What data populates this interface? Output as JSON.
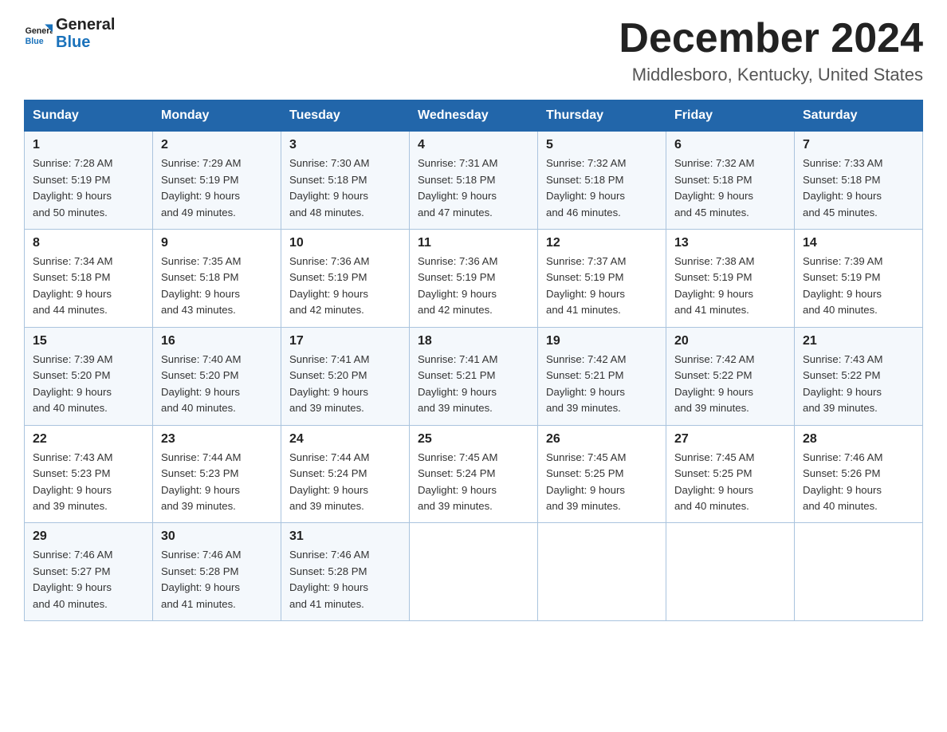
{
  "header": {
    "logo_text_general": "General",
    "logo_text_blue": "Blue",
    "month_title": "December 2024",
    "location": "Middlesboro, Kentucky, United States"
  },
  "weekdays": [
    "Sunday",
    "Monday",
    "Tuesday",
    "Wednesday",
    "Thursday",
    "Friday",
    "Saturday"
  ],
  "weeks": [
    [
      {
        "day": "1",
        "sunrise": "7:28 AM",
        "sunset": "5:19 PM",
        "daylight": "9 hours and 50 minutes."
      },
      {
        "day": "2",
        "sunrise": "7:29 AM",
        "sunset": "5:19 PM",
        "daylight": "9 hours and 49 minutes."
      },
      {
        "day": "3",
        "sunrise": "7:30 AM",
        "sunset": "5:18 PM",
        "daylight": "9 hours and 48 minutes."
      },
      {
        "day": "4",
        "sunrise": "7:31 AM",
        "sunset": "5:18 PM",
        "daylight": "9 hours and 47 minutes."
      },
      {
        "day": "5",
        "sunrise": "7:32 AM",
        "sunset": "5:18 PM",
        "daylight": "9 hours and 46 minutes."
      },
      {
        "day": "6",
        "sunrise": "7:32 AM",
        "sunset": "5:18 PM",
        "daylight": "9 hours and 45 minutes."
      },
      {
        "day": "7",
        "sunrise": "7:33 AM",
        "sunset": "5:18 PM",
        "daylight": "9 hours and 45 minutes."
      }
    ],
    [
      {
        "day": "8",
        "sunrise": "7:34 AM",
        "sunset": "5:18 PM",
        "daylight": "9 hours and 44 minutes."
      },
      {
        "day": "9",
        "sunrise": "7:35 AM",
        "sunset": "5:18 PM",
        "daylight": "9 hours and 43 minutes."
      },
      {
        "day": "10",
        "sunrise": "7:36 AM",
        "sunset": "5:19 PM",
        "daylight": "9 hours and 42 minutes."
      },
      {
        "day": "11",
        "sunrise": "7:36 AM",
        "sunset": "5:19 PM",
        "daylight": "9 hours and 42 minutes."
      },
      {
        "day": "12",
        "sunrise": "7:37 AM",
        "sunset": "5:19 PM",
        "daylight": "9 hours and 41 minutes."
      },
      {
        "day": "13",
        "sunrise": "7:38 AM",
        "sunset": "5:19 PM",
        "daylight": "9 hours and 41 minutes."
      },
      {
        "day": "14",
        "sunrise": "7:39 AM",
        "sunset": "5:19 PM",
        "daylight": "9 hours and 40 minutes."
      }
    ],
    [
      {
        "day": "15",
        "sunrise": "7:39 AM",
        "sunset": "5:20 PM",
        "daylight": "9 hours and 40 minutes."
      },
      {
        "day": "16",
        "sunrise": "7:40 AM",
        "sunset": "5:20 PM",
        "daylight": "9 hours and 40 minutes."
      },
      {
        "day": "17",
        "sunrise": "7:41 AM",
        "sunset": "5:20 PM",
        "daylight": "9 hours and 39 minutes."
      },
      {
        "day": "18",
        "sunrise": "7:41 AM",
        "sunset": "5:21 PM",
        "daylight": "9 hours and 39 minutes."
      },
      {
        "day": "19",
        "sunrise": "7:42 AM",
        "sunset": "5:21 PM",
        "daylight": "9 hours and 39 minutes."
      },
      {
        "day": "20",
        "sunrise": "7:42 AM",
        "sunset": "5:22 PM",
        "daylight": "9 hours and 39 minutes."
      },
      {
        "day": "21",
        "sunrise": "7:43 AM",
        "sunset": "5:22 PM",
        "daylight": "9 hours and 39 minutes."
      }
    ],
    [
      {
        "day": "22",
        "sunrise": "7:43 AM",
        "sunset": "5:23 PM",
        "daylight": "9 hours and 39 minutes."
      },
      {
        "day": "23",
        "sunrise": "7:44 AM",
        "sunset": "5:23 PM",
        "daylight": "9 hours and 39 minutes."
      },
      {
        "day": "24",
        "sunrise": "7:44 AM",
        "sunset": "5:24 PM",
        "daylight": "9 hours and 39 minutes."
      },
      {
        "day": "25",
        "sunrise": "7:45 AM",
        "sunset": "5:24 PM",
        "daylight": "9 hours and 39 minutes."
      },
      {
        "day": "26",
        "sunrise": "7:45 AM",
        "sunset": "5:25 PM",
        "daylight": "9 hours and 39 minutes."
      },
      {
        "day": "27",
        "sunrise": "7:45 AM",
        "sunset": "5:25 PM",
        "daylight": "9 hours and 40 minutes."
      },
      {
        "day": "28",
        "sunrise": "7:46 AM",
        "sunset": "5:26 PM",
        "daylight": "9 hours and 40 minutes."
      }
    ],
    [
      {
        "day": "29",
        "sunrise": "7:46 AM",
        "sunset": "5:27 PM",
        "daylight": "9 hours and 40 minutes."
      },
      {
        "day": "30",
        "sunrise": "7:46 AM",
        "sunset": "5:28 PM",
        "daylight": "9 hours and 41 minutes."
      },
      {
        "day": "31",
        "sunrise": "7:46 AM",
        "sunset": "5:28 PM",
        "daylight": "9 hours and 41 minutes."
      },
      null,
      null,
      null,
      null
    ]
  ],
  "labels": {
    "sunrise": "Sunrise:",
    "sunset": "Sunset:",
    "daylight": "Daylight:"
  }
}
